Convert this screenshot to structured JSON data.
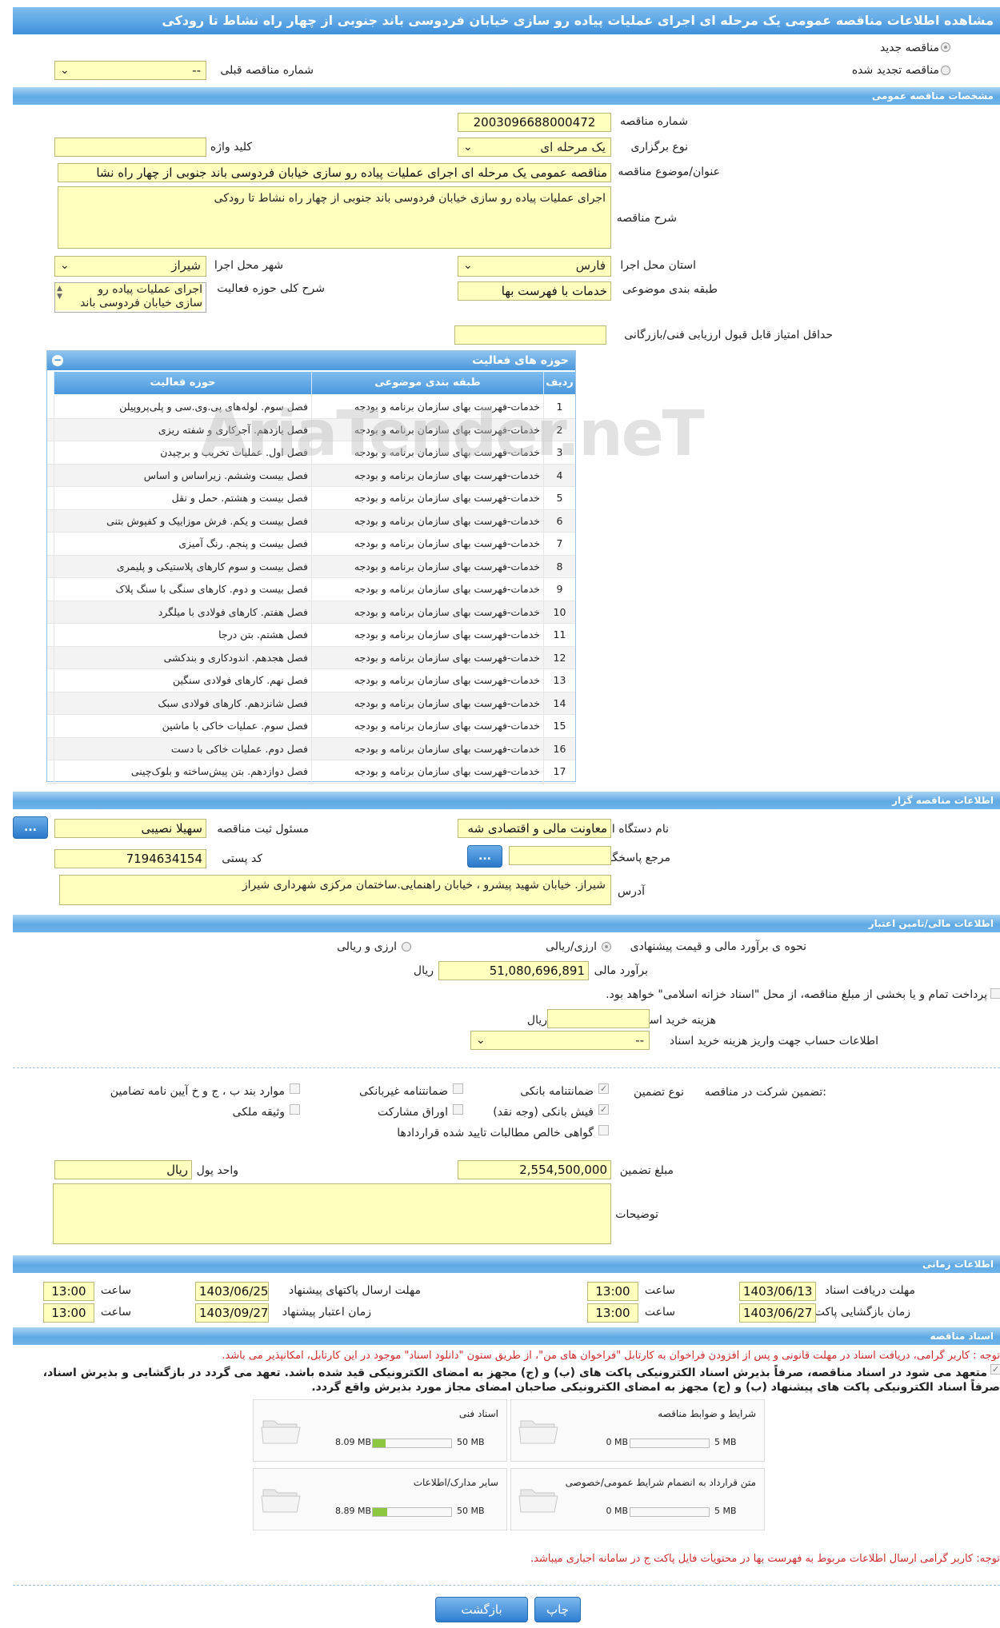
{
  "header": {
    "title": "مشاهده اطلاعات مناقصه عمومی یک مرحله ای اجرای عملیات پیاده رو سازی خیابان فردوسی باند جنوبی از چهار راه نشاط تا رودکی"
  },
  "top": {
    "new_label": "مناقصه جدید",
    "renewed_label": "مناقصه تجدید شده",
    "prev_number_label": "شماره مناقصه قبلی",
    "prev_number_value": "--"
  },
  "general": {
    "section_title": "مشخصات مناقصه عمومی",
    "number_label": "شماره مناقصه",
    "number_value": "2003096688000472",
    "type_label": "نوع برگزاری",
    "type_value": "یک مرحله ای",
    "keyword_label": "کلید واژه",
    "keyword_value": "",
    "subject_label": "عنوان/موضوع مناقصه",
    "subject_value": "مناقصه عمومی یک مرحله ای اجرای عملیات پیاده رو سازی خیابان فردوسی باند جنوبی از چهار راه نشا",
    "desc_label": "شرح مناقصه",
    "desc_value": "اجرای عملیات پیاده رو سازی خیابان فردوسی باند جنوبی از چهار راه نشاط تا رودکی",
    "province_label": "استان محل اجرا",
    "province_value": "فارس",
    "city_label": "شهر محل اجرا",
    "city_value": "شیراز",
    "category_label": "طبقه بندی موضوعی",
    "category_value": "خدمات با فهرست بها",
    "activity_label": "شرح کلی حوزه فعالیت",
    "activity_line1": "اجرای عملیات پیاده رو",
    "activity_line2": "سازی خیابان فردوسی باند",
    "min_score_label": "حداقل امتیاز قابل قبول ارزیابی فنی/بازرگانی",
    "min_score_value": ""
  },
  "activities": {
    "panel_title": "حوزه های فعالیت",
    "col_row": "ردیف",
    "col_category": "طبقه بندی موضوعی",
    "col_activity": "حوزه فعالیت",
    "rows": [
      {
        "n": "1",
        "cat": "خدمات-فهرست بهای سازمان برنامه و بودجه",
        "act": "فصل سوم. لوله‌های پی.وی.سی و پلی‌پروپیلن"
      },
      {
        "n": "2",
        "cat": "خدمات-فهرست بهای سازمان برنامه و بودجه",
        "act": "فصل یازدهم. آجرکاری و شفته ریزی"
      },
      {
        "n": "3",
        "cat": "خدمات-فهرست بهای سازمان برنامه و بودجه",
        "act": "فصل اول. عملیات تخریب و برچیدن"
      },
      {
        "n": "4",
        "cat": "خدمات-فهرست بهای سازمان برنامه و بودجه",
        "act": "فصل بیست وششم. زیراساس و اساس"
      },
      {
        "n": "5",
        "cat": "خدمات-فهرست بهای سازمان برنامه و بودجه",
        "act": "فصل بیست و هشتم. حمل و نقل"
      },
      {
        "n": "6",
        "cat": "خدمات-فهرست بهای سازمان برنامه و بودجه",
        "act": "فصل بیست و یکم. فرش موزاییک و کفپوش بتنی"
      },
      {
        "n": "7",
        "cat": "خدمات-فهرست بهای سازمان برنامه و بودجه",
        "act": "فصل بیست و پنجم. رنگ آمیزی"
      },
      {
        "n": "8",
        "cat": "خدمات-فهرست بهای سازمان برنامه و بودجه",
        "act": "فصل بیست و سوم کارهای پلاستیکی و پلیمری"
      },
      {
        "n": "9",
        "cat": "خدمات-فهرست بهای سازمان برنامه و بودجه",
        "act": "فصل بیست و دوم. کارهای سنگی با سنگ پلاک"
      },
      {
        "n": "10",
        "cat": "خدمات-فهرست بهای سازمان برنامه و بودجه",
        "act": "فصل هفتم. کارهای فولادی با میلگرد"
      },
      {
        "n": "11",
        "cat": "خدمات-فهرست بهای سازمان برنامه و بودجه",
        "act": "فصل هشتم. بتن درجا"
      },
      {
        "n": "12",
        "cat": "خدمات-فهرست بهای سازمان برنامه و بودجه",
        "act": "فصل هجدهم. اندودکاری و بندکشی"
      },
      {
        "n": "13",
        "cat": "خدمات-فهرست بهای سازمان برنامه و بودجه",
        "act": "فصل نهم. کارهای فولادی سنگین"
      },
      {
        "n": "14",
        "cat": "خدمات-فهرست بهای سازمان برنامه و بودجه",
        "act": "فصل شانزدهم. کارهای فولادی سبک"
      },
      {
        "n": "15",
        "cat": "خدمات-فهرست بهای سازمان برنامه و بودجه",
        "act": "فصل سوم. عملیات خاکی با ماشین"
      },
      {
        "n": "16",
        "cat": "خدمات-فهرست بهای سازمان برنامه و بودجه",
        "act": "فصل دوم. عملیات خاکی با دست"
      },
      {
        "n": "17",
        "cat": "خدمات-فهرست بهای سازمان برنامه و بودجه",
        "act": "فصل دوازدهم. بتن پیش‌ساخته و بلوک‌چینی"
      }
    ]
  },
  "organizer": {
    "section_title": "اطلاعات مناقصه گزار",
    "org_label": "نام دستگاه اجرایی مناقصه گزار",
    "org_value": "معاونت مالی و اقتصادی شه",
    "reg_label": "مسئول ثبت مناقصه",
    "reg_value": "سهیلا نصیبی",
    "ref_label": "مرجع پاسخگویی",
    "ref_value": "",
    "postal_label": "کد پستی",
    "postal_value": "7194634154",
    "address_label": "آدرس",
    "address_value": "شیراز. خیابان شهید پیشرو ، خیابان راهنمایی.ساختمان مرکزی شهرداری شیراز",
    "dots": "..."
  },
  "finance": {
    "section_title": "اطلاعات مالی/تامین اعتبار",
    "method_label": "نحوه ی برآورد مالی و قیمت پیشنهادی",
    "opt1": "ارزی/ریالی",
    "opt2": "ارزی و ریالی",
    "estimate_label": "برآورد مالی",
    "estimate_value": "51,080,696,891",
    "rial": "ریال",
    "treasury_text": "پرداخت تمام و یا بخشی از مبلغ مناقصه، از محل \"اسناد خزانه اسلامی\" خواهد بود.",
    "doc_cost_label": "هزینه خرید اسناد",
    "doc_cost_value": "",
    "account_label": "اطلاعات حساب جهت واریز هزینه خرید اسناد",
    "account_value": "--"
  },
  "guarantee": {
    "participation_label": "تضمین شرکت در مناقصه:",
    "type_label": "نوع تضمین",
    "opts": [
      "ضمانتنامه بانکی",
      "ضمانتنامه غیربانکی",
      "موارد بند ب ، ج و خ آیین نامه تضامین",
      "فیش بانکی (وجه نقد)",
      "اوراق مشارکت",
      "وثیقه ملکی",
      "گواهی خالص مطالبات تایید شده قراردادها"
    ],
    "amount_label": "مبلغ تضمین",
    "amount_value": "2,554,500,000",
    "currency_label": "واحد پول",
    "currency_value": "ریال",
    "notes_label": "توضیحات",
    "notes_value": ""
  },
  "timing": {
    "section_title": "اطلاعات زمانی",
    "receive_label": "مهلت دریافت اسناد",
    "receive_date": "1403/06/13",
    "receive_time": "13:00",
    "send_label": "مهلت ارسال پاکتهای پیشنهاد",
    "send_date": "1403/06/25",
    "send_time": "13:00",
    "open_label": "زمان بازگشایی پاکت ها",
    "open_date": "1403/06/27",
    "open_time": "13:00",
    "validity_label": "زمان اعتبار پیشنهاد",
    "validity_date": "1403/09/27",
    "validity_time": "13:00",
    "time_label": "ساعت"
  },
  "documents": {
    "section_title": "اسناد مناقصه",
    "note1": "توجه : کاربر گرامی، دریافت اسناد در مهلت قانونی و پس از افزودن فراخوان به کارتابل \"فراخوان های من\"، از طریق ستون \"دانلود اسناد\" موجود در این کارتابل، امکانپذیر می باشد.",
    "commit_line1": "متعهد می شود در اسناد مناقصه، صرفاً بذیرش اسناد الکترونیکی پاکت های (ب) و (ج) مجهز به امضای الکترونیکی قید شده باشد. تعهد می گردد در بازگشایی و بذیرش اسناد،",
    "commit_line2": "صرفاً اسناد الکترونیکی پاکت های پیشنهاد (ب) و (ج) مجهز به امضای الکترونیکی صاحبان امضای مجاز مورد بذیرش واقع گردد.",
    "files": [
      {
        "label": "شرایط و ضوابط مناقصه",
        "current": "0 MB",
        "max": "5 MB",
        "fraction": 0.0
      },
      {
        "label": "اسناد فنی",
        "current": "8.09 MB",
        "max": "50 MB",
        "fraction": 0.16
      },
      {
        "label": "متن قرارداد به انضمام شرایط عمومی/خصوصی",
        "current": "0 MB",
        "max": "5 MB",
        "fraction": 0.0
      },
      {
        "label": "سایر مدارک/اطلاعات",
        "current": "8.89 MB",
        "max": "50 MB",
        "fraction": 0.18
      }
    ],
    "note2": "توجه: کاربر گرامی ارسال اطلاعات مربوط به فهرست بها در محتویات فایل پاکت ج در سامانه اجباری میباشد."
  },
  "footer": {
    "back_label": "بازگشت",
    "print_label": "چاپ"
  },
  "watermark": "AriaTender.neT",
  "colors": {
    "header_blue": "#3f90db",
    "field_yellow": "#ffffbe",
    "note_red": "#d02a2a"
  }
}
